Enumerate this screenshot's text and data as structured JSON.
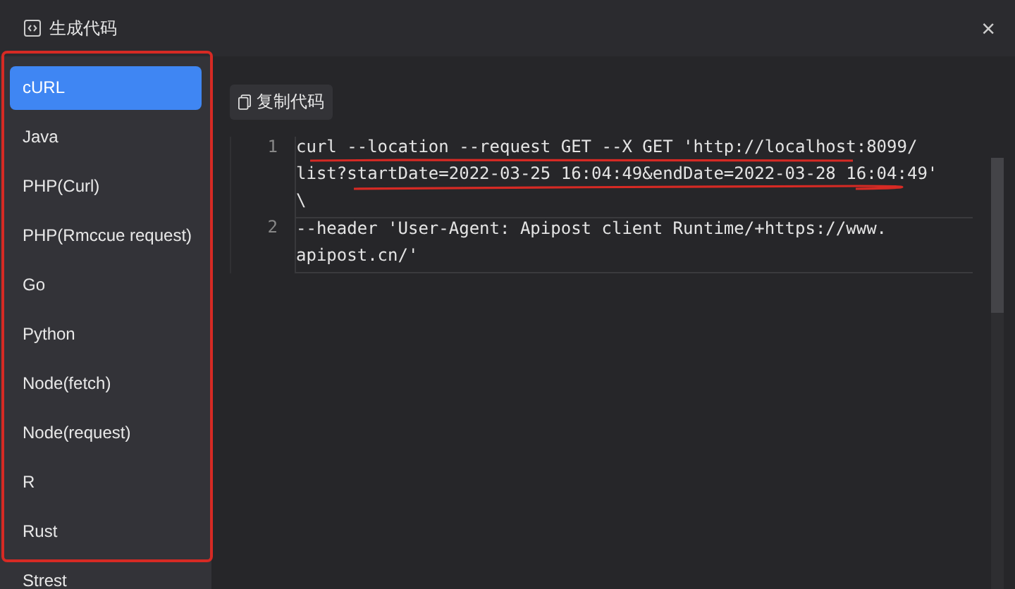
{
  "dialog": {
    "title": "生成代码",
    "close": "×"
  },
  "languages": [
    {
      "label": "cURL",
      "selected": true
    },
    {
      "label": "Java",
      "selected": false
    },
    {
      "label": "PHP(Curl)",
      "selected": false
    },
    {
      "label": "PHP(Rmccue request)",
      "selected": false
    },
    {
      "label": "Go",
      "selected": false
    },
    {
      "label": "Python",
      "selected": false
    },
    {
      "label": "Node(fetch)",
      "selected": false
    },
    {
      "label": "Node(request)",
      "selected": false
    },
    {
      "label": "R",
      "selected": false
    },
    {
      "label": "Rust",
      "selected": false
    },
    {
      "label": "Strest",
      "selected": false
    }
  ],
  "copy_button": "复制代码",
  "code_lines": [
    {
      "number": "1",
      "text": [
        "curl --location --request GET --X GET 'http://localhost:8099/",
        "list?startDate=2022-03-25 16:04:49&endDate=2022-03-28 16:04:49'",
        "\\"
      ]
    },
    {
      "number": "2",
      "text": [
        "--header 'User-Agent: Apipost client Runtime/+https://www.",
        "apipost.cn/'"
      ]
    }
  ]
}
